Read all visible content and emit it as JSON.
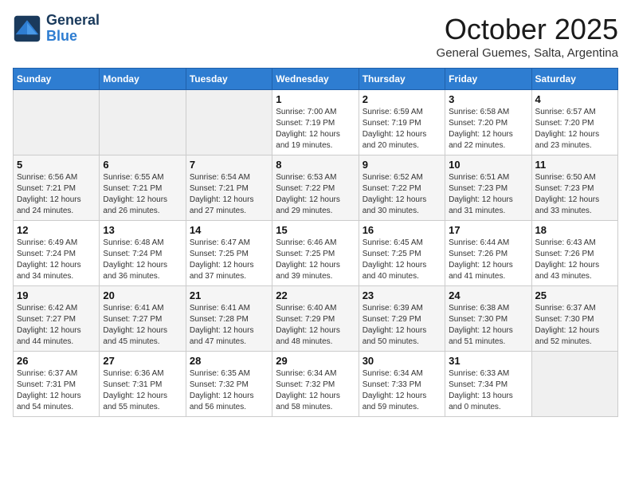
{
  "header": {
    "logo_line1": "General",
    "logo_line2": "Blue",
    "month": "October 2025",
    "location": "General Guemes, Salta, Argentina"
  },
  "weekdays": [
    "Sunday",
    "Monday",
    "Tuesday",
    "Wednesday",
    "Thursday",
    "Friday",
    "Saturday"
  ],
  "weeks": [
    [
      {
        "day": "",
        "info": ""
      },
      {
        "day": "",
        "info": ""
      },
      {
        "day": "",
        "info": ""
      },
      {
        "day": "1",
        "info": "Sunrise: 7:00 AM\nSunset: 7:19 PM\nDaylight: 12 hours\nand 19 minutes."
      },
      {
        "day": "2",
        "info": "Sunrise: 6:59 AM\nSunset: 7:19 PM\nDaylight: 12 hours\nand 20 minutes."
      },
      {
        "day": "3",
        "info": "Sunrise: 6:58 AM\nSunset: 7:20 PM\nDaylight: 12 hours\nand 22 minutes."
      },
      {
        "day": "4",
        "info": "Sunrise: 6:57 AM\nSunset: 7:20 PM\nDaylight: 12 hours\nand 23 minutes."
      }
    ],
    [
      {
        "day": "5",
        "info": "Sunrise: 6:56 AM\nSunset: 7:21 PM\nDaylight: 12 hours\nand 24 minutes."
      },
      {
        "day": "6",
        "info": "Sunrise: 6:55 AM\nSunset: 7:21 PM\nDaylight: 12 hours\nand 26 minutes."
      },
      {
        "day": "7",
        "info": "Sunrise: 6:54 AM\nSunset: 7:21 PM\nDaylight: 12 hours\nand 27 minutes."
      },
      {
        "day": "8",
        "info": "Sunrise: 6:53 AM\nSunset: 7:22 PM\nDaylight: 12 hours\nand 29 minutes."
      },
      {
        "day": "9",
        "info": "Sunrise: 6:52 AM\nSunset: 7:22 PM\nDaylight: 12 hours\nand 30 minutes."
      },
      {
        "day": "10",
        "info": "Sunrise: 6:51 AM\nSunset: 7:23 PM\nDaylight: 12 hours\nand 31 minutes."
      },
      {
        "day": "11",
        "info": "Sunrise: 6:50 AM\nSunset: 7:23 PM\nDaylight: 12 hours\nand 33 minutes."
      }
    ],
    [
      {
        "day": "12",
        "info": "Sunrise: 6:49 AM\nSunset: 7:24 PM\nDaylight: 12 hours\nand 34 minutes."
      },
      {
        "day": "13",
        "info": "Sunrise: 6:48 AM\nSunset: 7:24 PM\nDaylight: 12 hours\nand 36 minutes."
      },
      {
        "day": "14",
        "info": "Sunrise: 6:47 AM\nSunset: 7:25 PM\nDaylight: 12 hours\nand 37 minutes."
      },
      {
        "day": "15",
        "info": "Sunrise: 6:46 AM\nSunset: 7:25 PM\nDaylight: 12 hours\nand 39 minutes."
      },
      {
        "day": "16",
        "info": "Sunrise: 6:45 AM\nSunset: 7:25 PM\nDaylight: 12 hours\nand 40 minutes."
      },
      {
        "day": "17",
        "info": "Sunrise: 6:44 AM\nSunset: 7:26 PM\nDaylight: 12 hours\nand 41 minutes."
      },
      {
        "day": "18",
        "info": "Sunrise: 6:43 AM\nSunset: 7:26 PM\nDaylight: 12 hours\nand 43 minutes."
      }
    ],
    [
      {
        "day": "19",
        "info": "Sunrise: 6:42 AM\nSunset: 7:27 PM\nDaylight: 12 hours\nand 44 minutes."
      },
      {
        "day": "20",
        "info": "Sunrise: 6:41 AM\nSunset: 7:27 PM\nDaylight: 12 hours\nand 45 minutes."
      },
      {
        "day": "21",
        "info": "Sunrise: 6:41 AM\nSunset: 7:28 PM\nDaylight: 12 hours\nand 47 minutes."
      },
      {
        "day": "22",
        "info": "Sunrise: 6:40 AM\nSunset: 7:29 PM\nDaylight: 12 hours\nand 48 minutes."
      },
      {
        "day": "23",
        "info": "Sunrise: 6:39 AM\nSunset: 7:29 PM\nDaylight: 12 hours\nand 50 minutes."
      },
      {
        "day": "24",
        "info": "Sunrise: 6:38 AM\nSunset: 7:30 PM\nDaylight: 12 hours\nand 51 minutes."
      },
      {
        "day": "25",
        "info": "Sunrise: 6:37 AM\nSunset: 7:30 PM\nDaylight: 12 hours\nand 52 minutes."
      }
    ],
    [
      {
        "day": "26",
        "info": "Sunrise: 6:37 AM\nSunset: 7:31 PM\nDaylight: 12 hours\nand 54 minutes."
      },
      {
        "day": "27",
        "info": "Sunrise: 6:36 AM\nSunset: 7:31 PM\nDaylight: 12 hours\nand 55 minutes."
      },
      {
        "day": "28",
        "info": "Sunrise: 6:35 AM\nSunset: 7:32 PM\nDaylight: 12 hours\nand 56 minutes."
      },
      {
        "day": "29",
        "info": "Sunrise: 6:34 AM\nSunset: 7:32 PM\nDaylight: 12 hours\nand 58 minutes."
      },
      {
        "day": "30",
        "info": "Sunrise: 6:34 AM\nSunset: 7:33 PM\nDaylight: 12 hours\nand 59 minutes."
      },
      {
        "day": "31",
        "info": "Sunrise: 6:33 AM\nSunset: 7:34 PM\nDaylight: 13 hours\nand 0 minutes."
      },
      {
        "day": "",
        "info": ""
      }
    ]
  ]
}
